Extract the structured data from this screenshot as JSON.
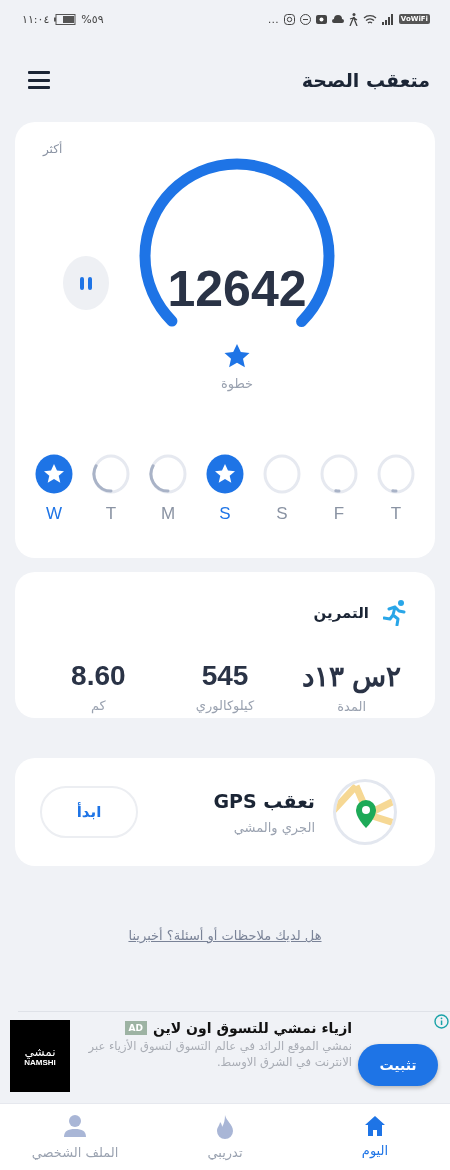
{
  "status_bar": {
    "time": "١١:٠٤",
    "battery": "%٥٩",
    "more": "…",
    "network": "VoWiFi"
  },
  "header": {
    "title": "متعقب الصحة"
  },
  "steps_card": {
    "more": "أكثر",
    "count": "12642",
    "unit": "خطوة",
    "paused": false,
    "days": [
      {
        "label": "T",
        "kind": "dot"
      },
      {
        "label": "F",
        "kind": "dot"
      },
      {
        "label": "S",
        "kind": "empty"
      },
      {
        "label": "S",
        "kind": "star"
      },
      {
        "label": "M",
        "kind": "arc"
      },
      {
        "label": "T",
        "kind": "arc"
      },
      {
        "label": "W",
        "kind": "star"
      }
    ]
  },
  "workout_card": {
    "title": "التمرين",
    "stats": [
      {
        "value": "٢س ١٣د",
        "label": "المدة"
      },
      {
        "value": "545",
        "label": "كيلوكالوري"
      },
      {
        "value": "8.60",
        "label": "كم"
      }
    ]
  },
  "gps_card": {
    "title": "تعقب GPS",
    "subtitle": "الجري والمشي",
    "button": "ابدأ"
  },
  "feedback_link": "هل لديك ملاحظات أو أسئلة؟ أخبرينا",
  "ad": {
    "badge": "AD",
    "title": "ازياء نمشي للتسوق اون لاين",
    "body": "نمشي الموقع الرائد في عالم التسوق لتسوق الأزياء عبر الانترنت في الشرق الاوسط.",
    "logo_arabic": "نمشي",
    "logo_latin": "NAMSHI",
    "button": "تثبيت"
  },
  "bottom_nav": [
    {
      "label": "اليوم",
      "kind": "home",
      "selected": true
    },
    {
      "label": "تدريبي",
      "kind": "flame",
      "selected": false
    },
    {
      "label": "الملف الشخصي",
      "kind": "person",
      "selected": false
    }
  ]
}
